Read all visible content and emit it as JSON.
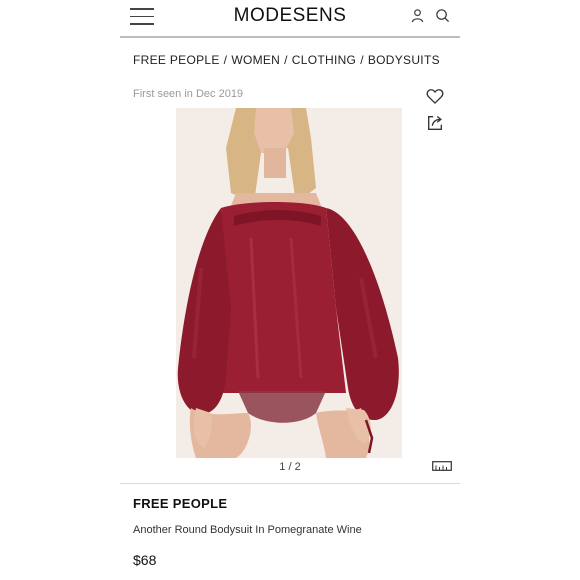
{
  "header": {
    "logo_text": "MODESENS",
    "icons": [
      "menu-icon",
      "user-icon",
      "search-icon"
    ]
  },
  "breadcrumb": {
    "items": [
      "FREE PEOPLE",
      "WOMEN",
      "CLOTHING",
      "BODYSUITS"
    ],
    "separator": "/"
  },
  "product": {
    "first_seen": "First seen in Dec 2019",
    "image_counter": "1 / 2",
    "brand": "FREE PEOPLE",
    "name": "Another Round Bodysuit In Pomegranate Wine",
    "price": "$68",
    "action_icons": [
      "heart-icon",
      "share-icon",
      "size-ruler-icon"
    ],
    "colors": {
      "garment": "#9b1f33",
      "background": "#f2e6df"
    }
  }
}
